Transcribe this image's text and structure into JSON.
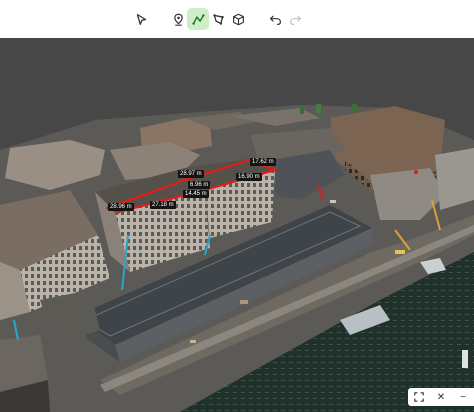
{
  "toolbar": {
    "tools": [
      {
        "name": "select",
        "icon": "cursor-arrow-icon"
      },
      {
        "name": "point",
        "icon": "location-pin-icon"
      },
      {
        "name": "polyline",
        "icon": "polyline-measure-icon",
        "active": true
      },
      {
        "name": "polygon",
        "icon": "polygon-area-icon"
      },
      {
        "name": "volume",
        "icon": "cube-icon"
      },
      {
        "name": "undo",
        "icon": "undo-icon"
      },
      {
        "name": "redo",
        "icon": "redo-icon",
        "disabled": true
      }
    ],
    "active_color": "#cdeec8"
  },
  "viewport": {
    "background": "#474747",
    "measure_color": "#e31b1b",
    "labels": [
      "28.97 m",
      "17.62 m",
      "6.96 m",
      "16.90 m",
      "14.45 m",
      "27.18 m",
      "28.96 m"
    ]
  },
  "corner_controls": {
    "fullscreen_icon": "fullscreen-icon",
    "close_icon": "close-icon",
    "minus_icon": "minus-icon",
    "close_glyph": "✕",
    "minus_glyph": "−"
  }
}
